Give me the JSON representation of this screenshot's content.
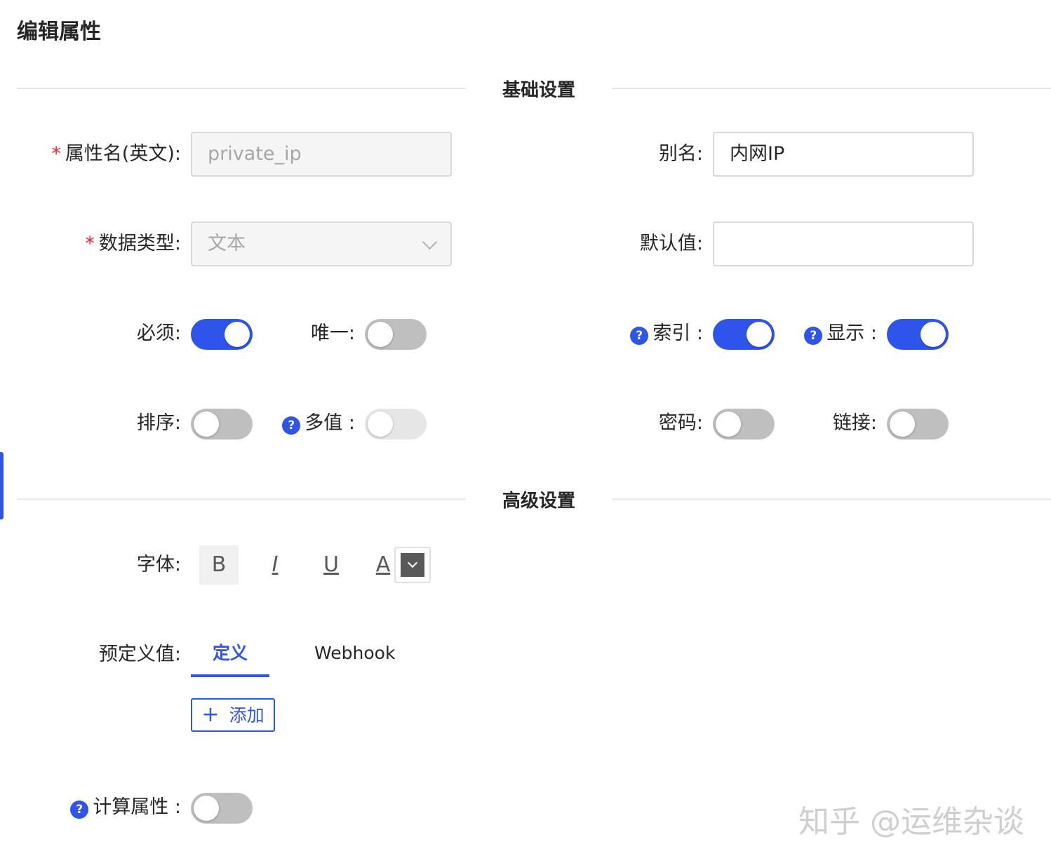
{
  "page": {
    "title": "编辑属性"
  },
  "sections": {
    "basic": "基础设置",
    "advanced": "高级设置"
  },
  "fields": {
    "name_en": {
      "label": "属性名(英文)",
      "value": "private_ip",
      "required": true
    },
    "alias": {
      "label": "别名",
      "value": "内网IP"
    },
    "data_type": {
      "label": "数据类型",
      "value": "文本",
      "required": true
    },
    "default_value": {
      "label": "默认值",
      "value": ""
    }
  },
  "switches": {
    "required": {
      "label": "必须",
      "on": true
    },
    "unique": {
      "label": "唯一",
      "on": false
    },
    "index": {
      "label": "索引",
      "on": true,
      "help": "?"
    },
    "display": {
      "label": "显示",
      "on": true,
      "help": "?"
    },
    "sort": {
      "label": "排序",
      "on": false
    },
    "multi": {
      "label": "多值",
      "on": false,
      "disabled": true,
      "help": "?"
    },
    "password": {
      "label": "密码",
      "on": false
    },
    "link": {
      "label": "链接",
      "on": false
    },
    "computed": {
      "label": "计算属性",
      "on": false,
      "help": "?"
    }
  },
  "font": {
    "label": "字体",
    "bold": "B",
    "italic": "I",
    "underline": "U",
    "color_letter": "A",
    "color_value": "#595959"
  },
  "predefined": {
    "label": "预定义值",
    "tabs": [
      "定义",
      "Webhook"
    ],
    "active_tab": 0,
    "add_label": "添加",
    "add_icon": "+"
  },
  "colors": {
    "primary": "#2f54eb",
    "required_star": "#f5222d"
  },
  "watermark": "知乎 @运维杂谈"
}
